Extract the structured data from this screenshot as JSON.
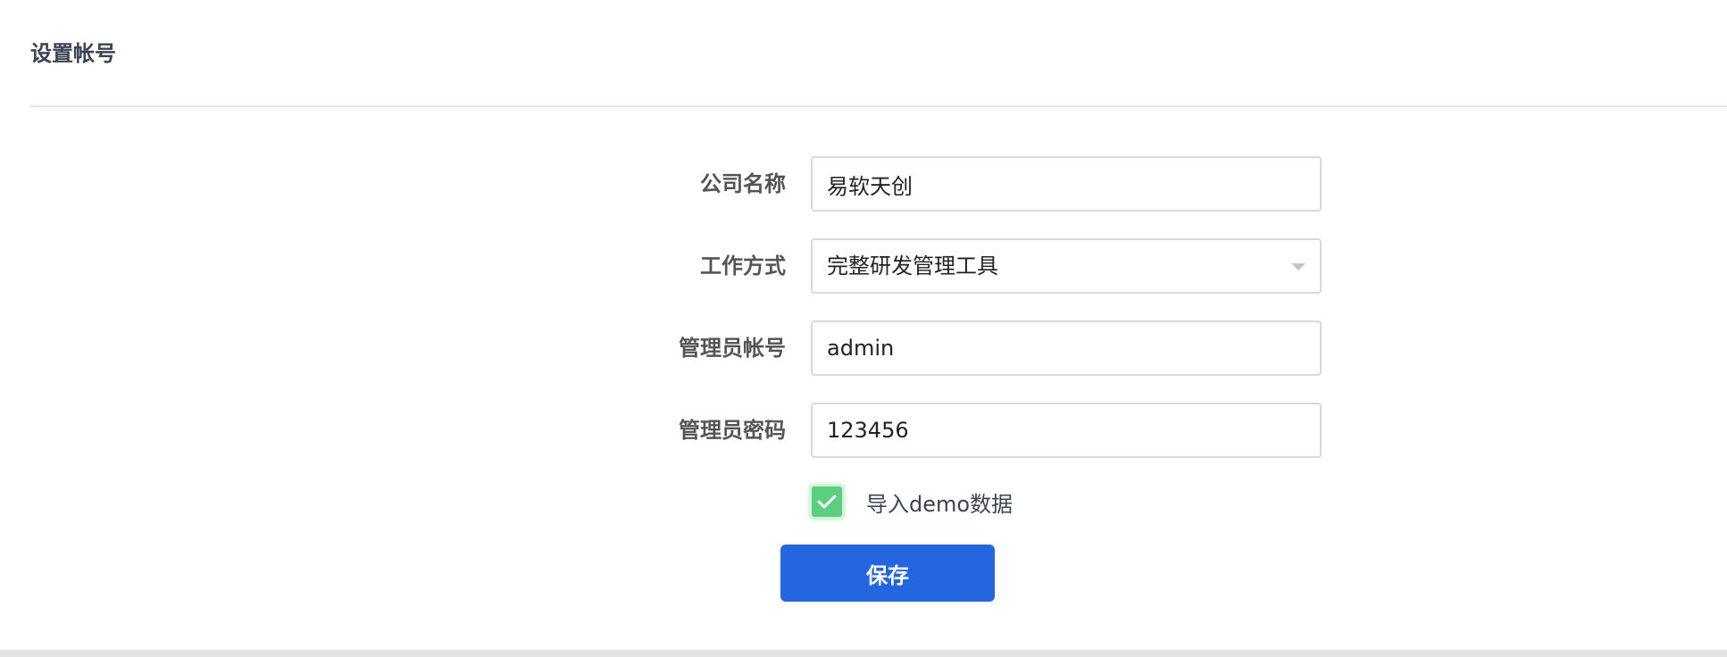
{
  "header": {
    "title": "设置帐号"
  },
  "form": {
    "company_name": {
      "label": "公司名称",
      "value": "易软天创"
    },
    "work_mode": {
      "label": "工作方式",
      "selected": "完整研发管理工具"
    },
    "admin_account": {
      "label": "管理员帐号",
      "value": "admin"
    },
    "admin_password": {
      "label": "管理员密码",
      "value": "123456"
    },
    "import_demo": {
      "label": "导入demo数据",
      "checked": true
    },
    "save_label": "保存"
  },
  "colors": {
    "primary": "#2366e0",
    "checkbox": "#5ccf7f",
    "title_text": "#3c4353",
    "label_text": "#545454",
    "border": "#d9d9d9"
  },
  "icons": {
    "dropdown": "caret-down-icon",
    "checkbox": "checkmark-icon"
  }
}
